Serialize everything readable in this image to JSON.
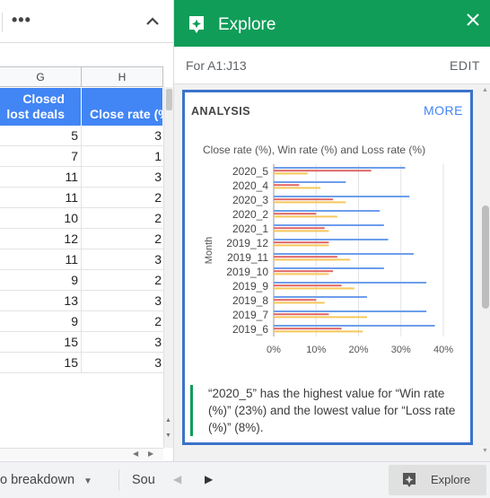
{
  "toolbar": {
    "more_label": "•••"
  },
  "sheet": {
    "col_g": "G",
    "col_h": "H",
    "header_g": "Closed lost deals",
    "header_h": "Close rate (%)",
    "rows": [
      {
        "g": "5",
        "h": "3"
      },
      {
        "g": "7",
        "h": "1"
      },
      {
        "g": "11",
        "h": "3"
      },
      {
        "g": "11",
        "h": "2"
      },
      {
        "g": "10",
        "h": "2"
      },
      {
        "g": "12",
        "h": "2"
      },
      {
        "g": "11",
        "h": "3"
      },
      {
        "g": "9",
        "h": "2"
      },
      {
        "g": "13",
        "h": "3"
      },
      {
        "g": "9",
        "h": "2"
      },
      {
        "g": "15",
        "h": "3"
      },
      {
        "g": "15",
        "h": "3"
      }
    ]
  },
  "tabs": {
    "breakdown": "o breakdown",
    "source": "Sou",
    "explore_label": "Explore"
  },
  "panel": {
    "title": "Explore",
    "for_label": "For A1:J13",
    "edit_label": "EDIT",
    "analysis_label": "ANALYSIS",
    "more_label": "MORE",
    "insight": "“2020_5” has the highest value for “Win rate (%)” (23%) and the lowest value for “Loss rate (%)” (8%)."
  },
  "colors": {
    "green": "#0f9d58",
    "blue": "#4285f4",
    "close": "#6d9eeb",
    "win": "#e06666",
    "loss": "#f6c75a"
  },
  "chart_data": {
    "type": "bar",
    "orientation": "horizontal",
    "title": "Close rate (%), Win rate (%) and Loss rate (%)",
    "ylabel": "Month",
    "xlabel": "",
    "xlim": [
      0,
      40
    ],
    "x_ticks": [
      "0%",
      "10%",
      "20%",
      "30%",
      "40%"
    ],
    "categories": [
      "2020_5",
      "2020_4",
      "2020_3",
      "2020_2",
      "2020_1",
      "2019_12",
      "2019_11",
      "2019_10",
      "2019_9",
      "2019_8",
      "2019_7",
      "2019_6"
    ],
    "series": [
      {
        "color": "#6d9eeb",
        "values": [
          31,
          17,
          32,
          25,
          26,
          27,
          33,
          26,
          36,
          22,
          36,
          38
        ]
      },
      {
        "color": "#e06666",
        "values": [
          23,
          6,
          14,
          10,
          12,
          13,
          15,
          14,
          16,
          10,
          13,
          16
        ]
      },
      {
        "color": "#f6c75a",
        "values": [
          8,
          11,
          17,
          15,
          13,
          13,
          18,
          13,
          19,
          12,
          22,
          21
        ]
      }
    ],
    "grid": true
  }
}
